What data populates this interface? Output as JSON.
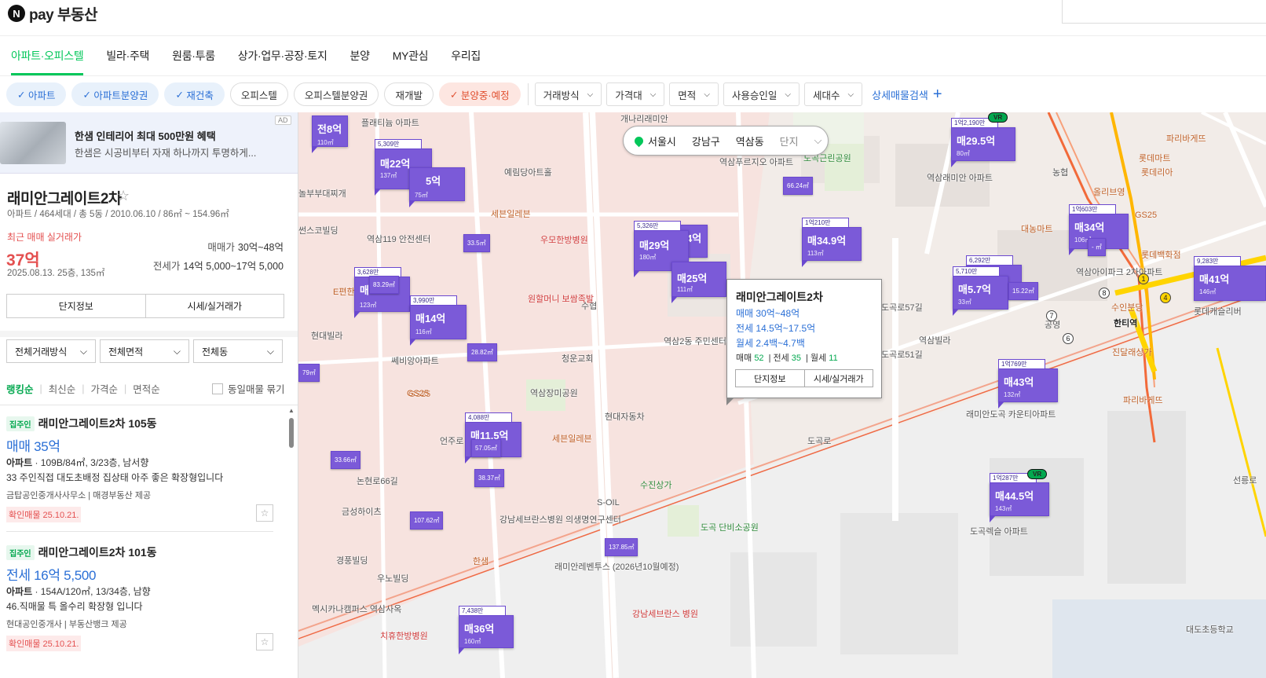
{
  "header": {
    "logo_letter": "N",
    "logo_text": "pay 부동산"
  },
  "nav": {
    "tabs": [
      "아파트·오피스텔",
      "빌라·주택",
      "원룸·투룸",
      "상가·업무·공장·토지",
      "분양",
      "MY관심",
      "우리집"
    ],
    "active": 0
  },
  "filters": {
    "chips": [
      {
        "label": "아파트",
        "state": "on"
      },
      {
        "label": "아파트분양권",
        "state": "on"
      },
      {
        "label": "재건축",
        "state": "on"
      },
      {
        "label": "오피스텔",
        "state": "off"
      },
      {
        "label": "오피스텔분양권",
        "state": "off"
      },
      {
        "label": "재개발",
        "state": "off"
      },
      {
        "label": "분양중·예정",
        "state": "hot"
      }
    ],
    "dropdowns": [
      "거래방식",
      "가격대",
      "면적",
      "사용승인일",
      "세대수"
    ],
    "advanced": "상세매물검색"
  },
  "ad": {
    "title": "한샘 인테리어 최대 500만원 혜택",
    "desc": "한샘은 시공비부터 자재 하나까지 투명하게...",
    "badge": "AD"
  },
  "complex": {
    "name": "래미안그레이트2차",
    "meta": "아파트 / 464세대 / 총 5동 / 2010.06.10 / 86㎡ ~ 154.96㎡",
    "recent_label": "최근 매매 실거래가",
    "recent_price": "37억",
    "recent_date": "2025.08.13. 25층, 135㎡",
    "sale_label": "매매가",
    "sale_range": "30억~48억",
    "jeonse_label": "전세가",
    "jeonse_range": "14억 5,000~17억 5,000",
    "btn_info": "단지정보",
    "btn_price": "시세/실거래가"
  },
  "list_filters": {
    "trade": "전체거래방식",
    "area": "전체면적",
    "dong": "전체동"
  },
  "sort": {
    "options": [
      "랭킹순",
      "최신순",
      "가격순",
      "면적순"
    ],
    "active": 0,
    "same_label": "동일매물 묶기"
  },
  "listings": [
    {
      "badge": "집주인",
      "title": "래미안그레이트2차 105동",
      "price": "매매 35억",
      "spec_type": "아파트",
      "spec": "109B/84㎡, 3/23층, 남서향",
      "desc": "33 주인직접 대도초배정 집상태 아주 좋은 확장형입니다",
      "agent1": "금탑공인중개사사무소",
      "agent2": "매경부동산 제공",
      "confirm": "확인매물 25.10.21."
    },
    {
      "badge": "집주인",
      "title": "래미안그레이트2차 101동",
      "price": "전세 16억 5,500",
      "spec_type": "아파트",
      "spec": "154A/120㎡, 13/34층, 남향",
      "desc": "46.직매물 특 올수리 확장형 입니다",
      "agent1": "현대공인중개사",
      "agent2": "부동산뱅크 제공",
      "confirm": "확인매물 25.10.21."
    }
  ],
  "map": {
    "location": {
      "city": "서울시",
      "district": "강남구",
      "dong": "역삼동",
      "mode": "단지"
    },
    "popup": {
      "title": "래미안그레이트2차",
      "sale": "매매 30억~48억",
      "jeonse": "전세 14.5억~17.5억",
      "monthly": "월세 2.4백~4.7백",
      "c_sale_label": "매매",
      "c_sale": "52",
      "c_jeonse_label": "전세",
      "c_jeonse": "35",
      "c_month_label": "월세",
      "c_month": "11",
      "btn_info": "단지정보",
      "btn_price": "시세/실거래가"
    },
    "markers": [
      {
        "count": "",
        "price": "전8억",
        "area": "110㎡"
      },
      {
        "count": "5,309만",
        "price": "매22억",
        "area": "137㎡"
      },
      {
        "count": "",
        "price": "5억",
        "area": "75㎡"
      },
      {
        "count": "5,326만",
        "price": "매29억",
        "area": "180㎡"
      },
      {
        "count": "",
        "price": "4억",
        "area": ""
      },
      {
        "count": "",
        "price": "매25억",
        "area": "111㎡"
      },
      {
        "count": "1억210만",
        "price": "매34.9억",
        "area": "113㎡"
      },
      {
        "count": "1억2,190만",
        "price": "매29.5억",
        "area": "80㎡"
      },
      {
        "count": "1억603만",
        "price": "매34억",
        "area": "106㎡"
      },
      {
        "count": "6,292만",
        "price": "",
        "area": ""
      },
      {
        "count": "5,710만",
        "price": "매5.7억",
        "area": "33㎡"
      },
      {
        "count": "9,283만",
        "price": "매41억",
        "area": "146㎡"
      },
      {
        "count": "3,628만",
        "price": "매",
        "area": "123㎡"
      },
      {
        "count": "3,990만",
        "price": "매14억",
        "area": "116㎡"
      },
      {
        "count": "1억769만",
        "price": "매43억",
        "area": "132㎡"
      },
      {
        "count": "4,088만",
        "price": "매11.5억",
        "area": ""
      },
      {
        "count": "1억287만",
        "price": "매44.5억",
        "area": "143㎡"
      },
      {
        "count": "7,438만",
        "price": "매36억",
        "area": "160㎡"
      }
    ],
    "small_markers": [
      "33.5㎡",
      "66.24㎡",
      "83.29㎡",
      "28.82㎡",
      "15.22㎡",
      "57.05㎡",
      "38.37㎡",
      "33.66㎡",
      "107.62㎡",
      "137.85㎡",
      "79㎡",
      "- ㎡"
    ],
    "vr": "VR",
    "places": [
      "개나리래미안",
      "역삼푸르지오 아파트",
      "도곡근린공원",
      "역삼래미안 아파트",
      "농협",
      "올리브영",
      "롯데리아",
      "파리바게뜨",
      "대농마트",
      "GS25",
      "롯데백화점",
      "한티역",
      "진달래상가",
      "파리바게뜨",
      "역삼빌라",
      "래미안도곡 카운티아파트",
      "도곡렉슬 아파트",
      "대도초등학교",
      "역삼2동 주민센터",
      "청운교회",
      "역삼장미공원",
      "현대자동차",
      "세븐일레븐",
      "수협",
      "원할머니 보쌈족발",
      "우모한방병원",
      "세븐일레븐",
      "예림당아트홀",
      "플래티늄 아파트",
      "놀부부대찌개",
      "썬스코빌딩",
      "역삼119 안전센터",
      "E편한",
      "현대빌라",
      "쎄비앙아파트",
      "GS25",
      "논현로66길",
      "금성하이츠",
      "경풍빌딩",
      "우노빌딩",
      "멕시카나캠퍼스 역삼사옥",
      "한샘",
      "강남세브란스병원 의생명연구센터",
      "S-OIL",
      "수진상가",
      "도곡 단비소공원",
      "래미안레벤투스 (2026년10월예정)",
      "강남세브란스 병원",
      "치휴한방병원",
      "도곡로",
      "도곡로57길",
      "도곡로51길",
      "선릉로",
      "언주로",
      "수인분당",
      "GS25",
      "롯데캐슬리버",
      "역삼아이파크 2차아파트",
      "공영",
      "롯데마트"
    ]
  }
}
